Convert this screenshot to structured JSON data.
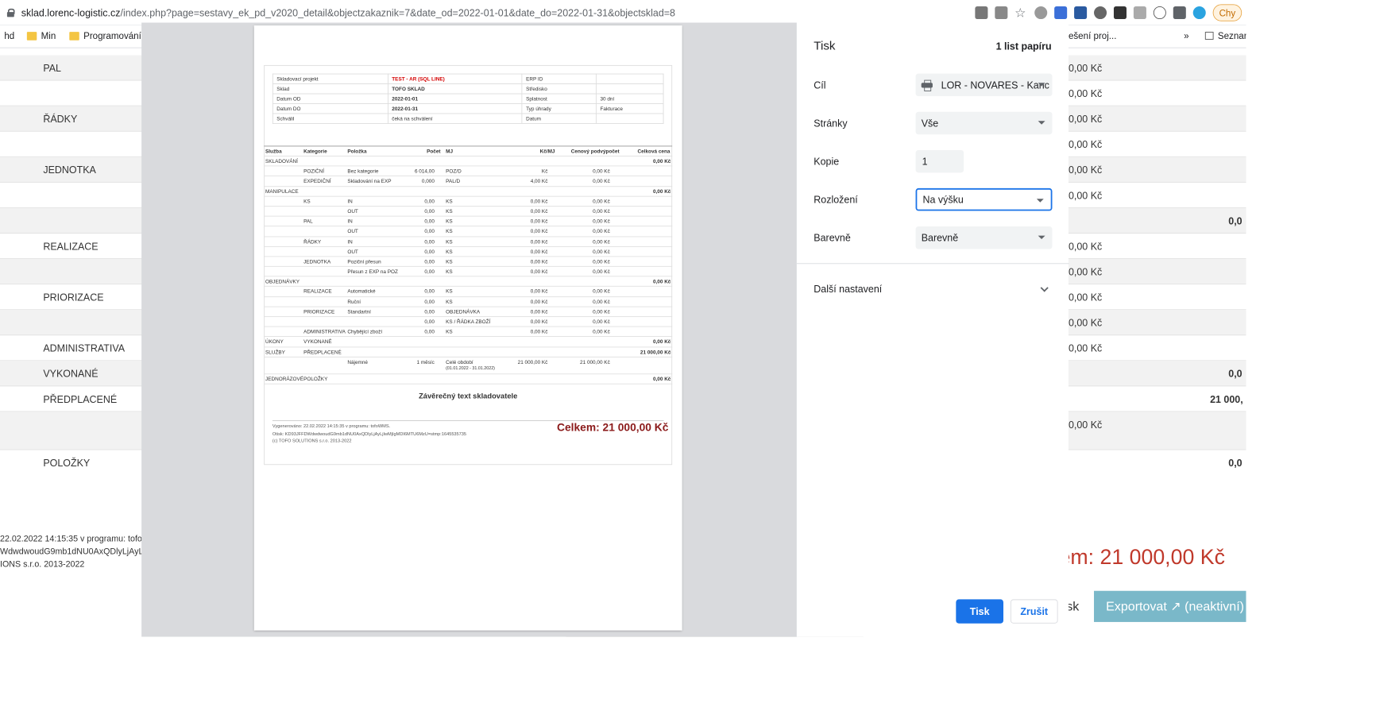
{
  "browser": {
    "url_domain": "sklad.lorenc-logistic.cz",
    "url_path": "/index.php?page=sestavy_ek_pd_v2020_detail&objectzakaznik=7&date_od=2022-01-01&date_do=2022-01-31&objectsklad=8",
    "profile_label": "Chy",
    "bookmarks": [
      "hd",
      "Min",
      "Programování"
    ],
    "bookmarks_right": [
      "ešení proj...",
      "»",
      "Seznar"
    ]
  },
  "background": {
    "rows": [
      "PAL",
      "",
      "ŘÁDKY",
      "",
      "JEDNOTKA",
      "",
      "",
      "REALIZACE",
      "",
      "PRIORIZACE",
      "",
      "ADMINISTRATIVA",
      "VYKONANÉ",
      "PŘEDPLACENÉ",
      "",
      "POLOŽKY"
    ],
    "values_right": [
      "0,00 Kč",
      "0,00 Kč",
      "0,00 Kč",
      "0,00 Kč",
      "0,00 Kč",
      "0,00 Kč",
      "0,00 Kč",
      "0,00 Kč",
      "0,00 Kč",
      "0,00 Kč",
      "0,00 Kč"
    ],
    "subtotals": [
      "0,0",
      "0,0",
      "21 000,",
      "0,0"
    ],
    "footer_lines": [
      "22.02.2022 14:15:35 v programu: tofoW",
      "WdwdwoudG9mb1dNU0AxQDlyLjAyLj",
      "IONS s.r.o. 2013-2022"
    ],
    "total_partial": "em: 21 000,00 Kč",
    "print_btn": "isk",
    "export_btn": "Exportovat ↗ (neaktivní)"
  },
  "preview": {
    "project": [
      [
        "Skladovací projekt",
        "TEST - AR (SQL LINE)",
        "ERP ID",
        ""
      ],
      [
        "Sklad",
        "TOFO SKLAD",
        "Středisko",
        ""
      ],
      [
        "Datum OD",
        "2022-01-01",
        "Splatnost",
        "30 dní"
      ],
      [
        "Datum DO",
        "2022-01-31",
        "Typ úhrady",
        "Fakturace"
      ],
      [
        "Schválil",
        "čeká na schválení",
        "Datum",
        ""
      ]
    ],
    "headers": [
      "Služba",
      "Kategorie",
      "Položka",
      "Počet",
      "MJ",
      "Kč/MJ",
      "Cenový podvýpočet",
      "Celková cena"
    ],
    "rows": [
      [
        "SKLADOVÁNÍ",
        "",
        "",
        "",
        "",
        "",
        "",
        "0,00 Kč"
      ],
      [
        "",
        "POZIČNÍ",
        "Bez kategorie",
        "6 014,00",
        "POZ/D",
        "Kč",
        "0,00 Kč",
        ""
      ],
      [
        "",
        "EXPEDIČNÍ",
        "Skladování na EXP",
        "0,000",
        "PAL/D",
        "4,00 Kč",
        "0,00 Kč",
        ""
      ],
      [
        "MANIPULACE",
        "",
        "",
        "",
        "",
        "",
        "",
        "0,00 Kč"
      ],
      [
        "",
        "KS",
        "IN",
        "0,00",
        "KS",
        "0,00 Kč",
        "0,00 Kč",
        ""
      ],
      [
        "",
        "",
        "OUT",
        "0,00",
        "KS",
        "0,00 Kč",
        "0,00 Kč",
        ""
      ],
      [
        "",
        "PAL",
        "IN",
        "0,00",
        "KS",
        "0,00 Kč",
        "0,00 Kč",
        ""
      ],
      [
        "",
        "",
        "OUT",
        "0,00",
        "KS",
        "0,00 Kč",
        "0,00 Kč",
        ""
      ],
      [
        "",
        "ŘÁDKY",
        "IN",
        "0,00",
        "KS",
        "0,00 Kč",
        "0,00 Kč",
        ""
      ],
      [
        "",
        "",
        "OUT",
        "0,00",
        "KS",
        "0,00 Kč",
        "0,00 Kč",
        ""
      ],
      [
        "",
        "JEDNOTKA",
        "Poziční přesun",
        "0,00",
        "KS",
        "0,00 Kč",
        "0,00 Kč",
        ""
      ],
      [
        "",
        "",
        "Přesun z EXP na POZ",
        "0,00",
        "KS",
        "0,00 Kč",
        "0,00 Kč",
        ""
      ],
      [
        "OBJEDNÁVKY",
        "",
        "",
        "",
        "",
        "",
        "",
        "0,00 Kč"
      ],
      [
        "",
        "REALIZACE",
        "Automatické",
        "0,00",
        "KS",
        "0,00 Kč",
        "0,00 Kč",
        ""
      ],
      [
        "",
        "",
        "Ruční",
        "0,00",
        "KS",
        "0,00 Kč",
        "0,00 Kč",
        ""
      ],
      [
        "",
        "PRIORIZACE",
        "Standartní",
        "0,00",
        "OBJEDNÁVKA",
        "0,00 Kč",
        "0,00 Kč",
        ""
      ],
      [
        "",
        "",
        "",
        "0,00",
        "KS / ŘÁDKA ZBOŽÍ",
        "0,00 Kč",
        "0,00 Kč",
        ""
      ],
      [
        "",
        "ADMINISTRATIVA",
        "Chybějící zboží",
        "0,00",
        "KS",
        "0,00 Kč",
        "0,00 Kč",
        ""
      ],
      [
        "ÚKONY",
        "VYKONANÉ",
        "",
        "",
        "",
        "",
        "",
        "0,00 Kč"
      ],
      [
        "SLUŽBY",
        "PŘEDPLACENÉ",
        "",
        "",
        "",
        "",
        "",
        "21 000,00 Kč"
      ],
      [
        "",
        "",
        "Nájemné",
        "1 měsíc",
        "Celé období",
        "21 000,00 Kč",
        "21 000,00 Kč",
        ""
      ],
      [
        "JEDNORÁZOVÉ",
        "POLOŽKY",
        "",
        "",
        "",
        "",
        "",
        "0,00 Kč"
      ]
    ],
    "period_note": "(01.01.2022 - 31.01.2022)",
    "closing_text": "Závěrečný text skladovatele",
    "generated": "Vygenerováno: 22.02.2022 14:15:35 v programu: tofoWMS.",
    "stamp": "Otisk: KD93JFFDWdwdwoudG9mb1dNU0AxQDlyLjAyLjIwMjIgMDI6MTU6MzU=stmp:1645535735",
    "copyright": "(c) TOFO SOLUTIONS s.r.o. 2013-2022",
    "total": "Celkem: 21 000,00 Kč"
  },
  "print_panel": {
    "title": "Tisk",
    "sheets": "1 list papíru",
    "destination_label": "Cíl",
    "destination_value": "LOR - NOVARES - Kanc",
    "pages_label": "Stránky",
    "pages_value": "Vše",
    "copies_label": "Kopie",
    "copies_value": "1",
    "layout_label": "Rozložení",
    "layout_value": "Na výšku",
    "color_label": "Barevně",
    "color_value": "Barevně",
    "more_settings": "Další nastavení",
    "print_button": "Tisk",
    "cancel_button": "Zrušit"
  }
}
